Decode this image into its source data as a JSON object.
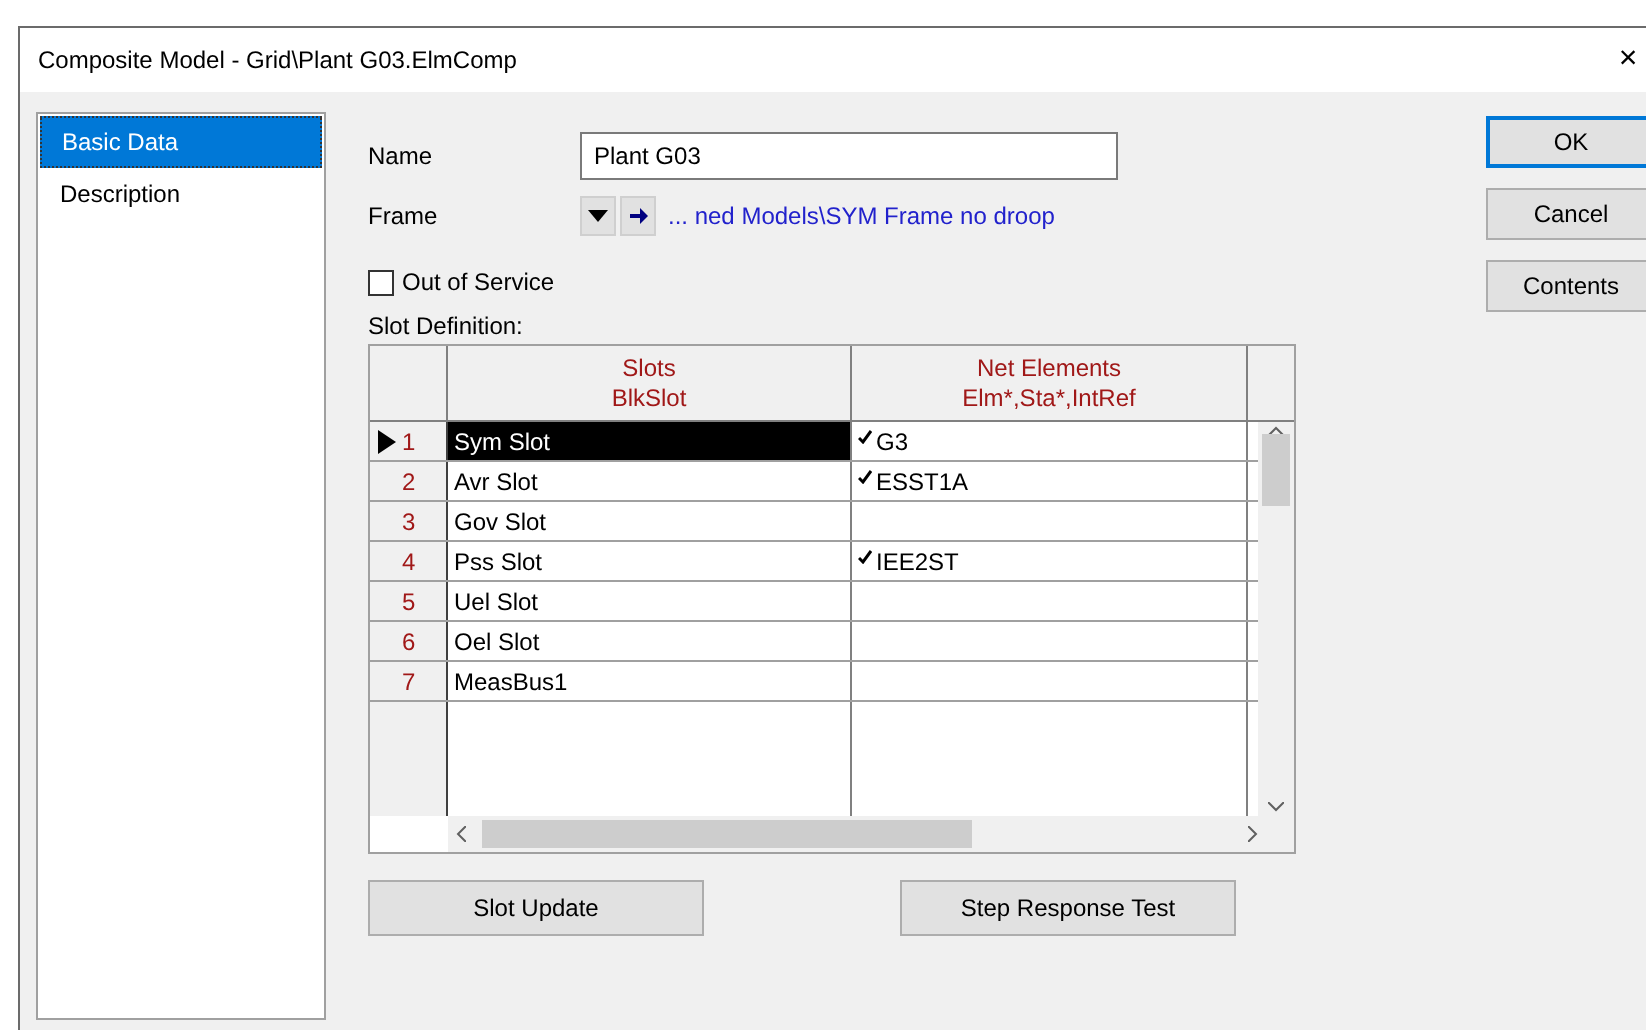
{
  "window": {
    "title": "Composite Model - Grid\\Plant G03.ElmComp",
    "close": "×"
  },
  "sidebar": {
    "items": [
      {
        "label": "Basic Data",
        "selected": true
      },
      {
        "label": "Description",
        "selected": false
      }
    ]
  },
  "form": {
    "name": {
      "label": "Name",
      "value": "Plant G03"
    },
    "frame": {
      "label": "Frame",
      "link": "... ned Models\\SYM Frame no droop"
    },
    "out_of_service": {
      "label": "Out of Service",
      "checked": false
    },
    "slot_definition_label": "Slot Definition:"
  },
  "table": {
    "columns": [
      {
        "title": "Slots",
        "subtitle": "BlkSlot"
      },
      {
        "title": "Net Elements",
        "subtitle": "Elm*,Sta*,IntRef"
      }
    ],
    "rows": [
      {
        "number": "1",
        "slot": "Sym Slot",
        "element": "G3",
        "checked": true,
        "selected": true
      },
      {
        "number": "2",
        "slot": "Avr Slot",
        "element": "ESST1A",
        "checked": true,
        "selected": false
      },
      {
        "number": "3",
        "slot": "Gov Slot",
        "element": "",
        "checked": false,
        "selected": false
      },
      {
        "number": "4",
        "slot": "Pss Slot",
        "element": "IEE2ST",
        "checked": true,
        "selected": false
      },
      {
        "number": "5",
        "slot": "Uel Slot",
        "element": "",
        "checked": false,
        "selected": false
      },
      {
        "number": "6",
        "slot": "Oel Slot",
        "element": "",
        "checked": false,
        "selected": false
      },
      {
        "number": "7",
        "slot": "MeasBus1",
        "element": "",
        "checked": false,
        "selected": false
      }
    ]
  },
  "actions": [
    "Slot Update",
    "Step Response Test"
  ],
  "buttons": [
    {
      "label": "OK",
      "default": true
    },
    {
      "label": "Cancel",
      "default": false
    },
    {
      "label": "Contents",
      "default": false
    }
  ]
}
